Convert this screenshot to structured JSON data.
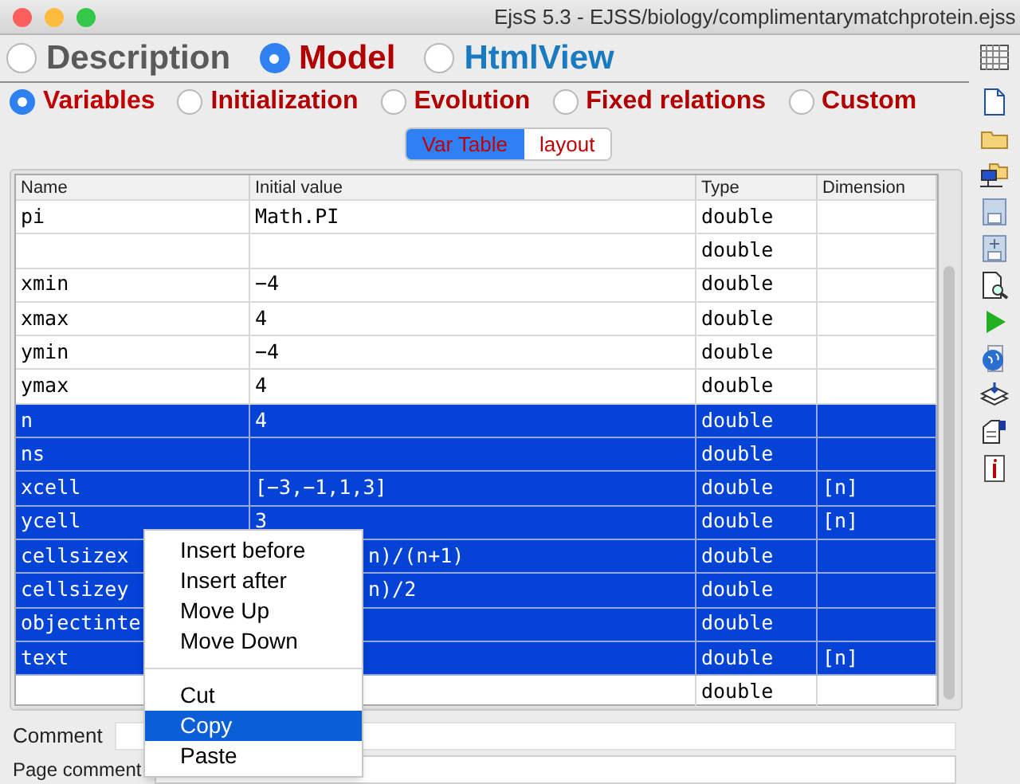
{
  "window": {
    "title": "EjsS 5.3 - EJSS/biology/complimentarymatchprotein.ejss"
  },
  "main_tabs": [
    {
      "label": "Description",
      "selected": false,
      "color": "#5a5a5a"
    },
    {
      "label": "Model",
      "selected": true,
      "color": "#b00000"
    },
    {
      "label": "HtmlView",
      "selected": false,
      "color": "#1a7ac0"
    }
  ],
  "sub_tabs": [
    {
      "label": "Variables",
      "selected": true
    },
    {
      "label": "Initialization",
      "selected": false
    },
    {
      "label": "Evolution",
      "selected": false
    },
    {
      "label": "Fixed relations",
      "selected": false
    },
    {
      "label": "Custom",
      "selected": false
    }
  ],
  "view_tabs": [
    {
      "label": "Var Table",
      "selected": true
    },
    {
      "label": "layout",
      "selected": false
    }
  ],
  "table": {
    "columns": [
      "Name",
      "Initial value",
      "Type",
      "Dimension"
    ],
    "rows": [
      {
        "name": "pi",
        "value": "Math.PI",
        "type": "double",
        "dimension": "",
        "selected": false
      },
      {
        "name": "",
        "value": "",
        "type": "double",
        "dimension": "",
        "selected": false
      },
      {
        "name": "xmin",
        "value": "−4",
        "type": "double",
        "dimension": "",
        "selected": false
      },
      {
        "name": "xmax",
        "value": "4",
        "type": "double",
        "dimension": "",
        "selected": false
      },
      {
        "name": "ymin",
        "value": "−4",
        "type": "double",
        "dimension": "",
        "selected": false
      },
      {
        "name": "ymax",
        "value": "4",
        "type": "double",
        "dimension": "",
        "selected": false
      },
      {
        "name": "n",
        "value": "4",
        "type": "double",
        "dimension": "",
        "selected": true
      },
      {
        "name": "ns",
        "value": "",
        "type": "double",
        "dimension": "",
        "selected": true
      },
      {
        "name": "xcell",
        "value": "[−3,−1,1,3]",
        "type": "double",
        "dimension": "[n]",
        "selected": true
      },
      {
        "name": "ycell",
        "value": "3",
        "type": "double",
        "dimension": "[n]",
        "selected": true
      },
      {
        "name": "cellsizex",
        "value": "n)/(n+1)",
        "covered": true,
        "type": "double",
        "dimension": "",
        "selected": true
      },
      {
        "name": "cellsizey",
        "value": "n)/2",
        "covered": true,
        "type": "double",
        "dimension": "",
        "selected": true
      },
      {
        "name": "objectinte",
        "value": "",
        "type": "double",
        "dimension": "",
        "selected": true
      },
      {
        "name": "text",
        "value": "",
        "type": "double",
        "dimension": "[n]",
        "selected": true
      },
      {
        "name": "",
        "value": "",
        "type": "double",
        "dimension": "",
        "selected": false
      }
    ]
  },
  "comment": {
    "label": "Comment"
  },
  "page_comment": {
    "label": "Page comment"
  },
  "context_menu": {
    "items": [
      {
        "label": "Insert before",
        "selected": false
      },
      {
        "label": "Insert after",
        "selected": false
      },
      {
        "label": "Move Up",
        "selected": false
      },
      {
        "label": "Move Down",
        "selected": false
      },
      {
        "kind": "separator"
      },
      {
        "label": "Cut",
        "selected": false
      },
      {
        "label": "Copy",
        "selected": true
      },
      {
        "label": "Paste",
        "selected": false
      }
    ]
  }
}
